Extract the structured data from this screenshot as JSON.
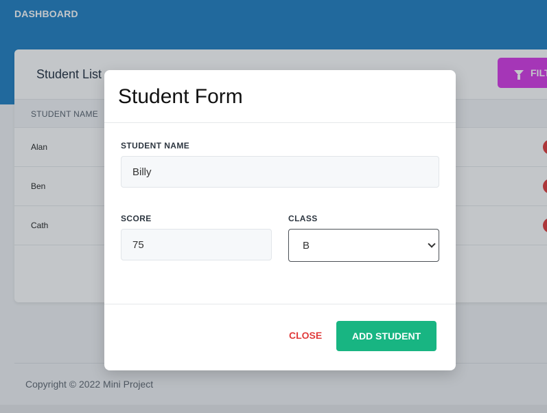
{
  "app": {
    "brand": "DASHBOARD"
  },
  "card": {
    "title": "Student List",
    "filter_label": "FILTER",
    "column_header": "STUDENT NAME",
    "rows": [
      {
        "name": "Alan"
      },
      {
        "name": "Ben"
      },
      {
        "name": "Cath"
      }
    ]
  },
  "footer": {
    "copyright": "Copyright © 2022 Mini Project"
  },
  "modal": {
    "title": "Student Form",
    "student_name_label": "STUDENT NAME",
    "student_name_value": "Billy",
    "score_label": "SCORE",
    "score_value": "75",
    "class_label": "CLASS",
    "class_value": "B",
    "close_label": "CLOSE",
    "add_label": "ADD STUDENT"
  },
  "colors": {
    "header_blue": "#1f7ec2",
    "filter_purple": "#d638e7",
    "add_green": "#18b582",
    "close_red": "#e03a3a"
  },
  "icons": {
    "filter": "funnel-icon",
    "delete": "delete-icon",
    "select": "chevron-down-icon"
  }
}
